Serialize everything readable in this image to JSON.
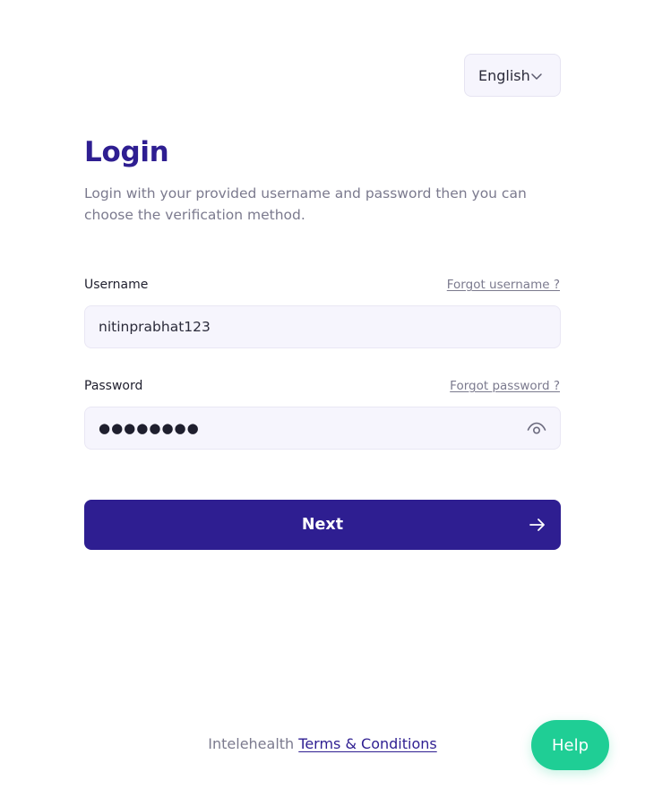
{
  "language": {
    "selected": "English",
    "icon": "chevron-down-icon"
  },
  "header": {
    "title": "Login",
    "subtitle": "Login with your provided username and password then you can choose the verification method."
  },
  "username": {
    "label": "Username",
    "forgot_link": "Forgot username ?",
    "value": "nitinprabhat123"
  },
  "password": {
    "label": "Password",
    "forgot_link": "Forgot password ?",
    "masked_value": "●●●●●●●●",
    "toggle_icon": "eye-icon"
  },
  "next_button": {
    "label": "Next",
    "icon": "arrow-right-icon"
  },
  "footer": {
    "brand": "Intelehealth",
    "terms_link": "Terms & Conditions"
  },
  "help_button": {
    "label": "Help"
  },
  "colors": {
    "primary": "#2e1e91",
    "accent_green": "#1fce95",
    "input_background": "#f6f5fd",
    "muted_text": "#7b7a8e"
  }
}
